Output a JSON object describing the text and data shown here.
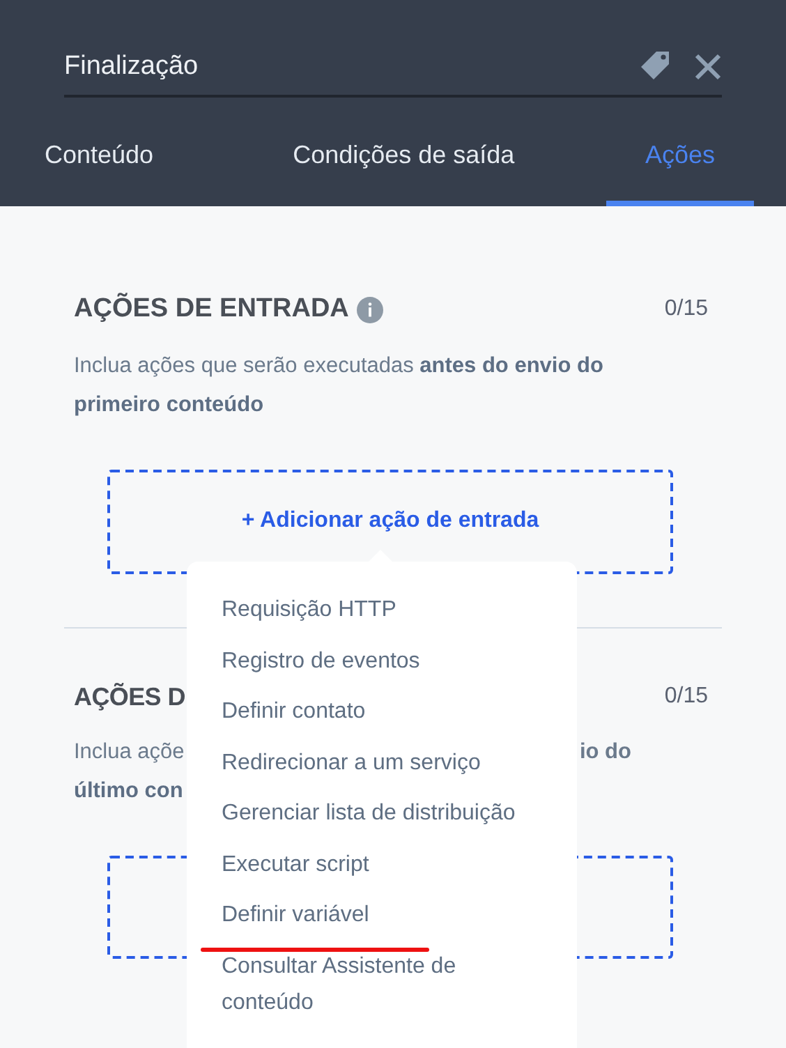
{
  "header": {
    "title": "Finalização"
  },
  "tabs": [
    {
      "label": "Conteúdo",
      "selected": false
    },
    {
      "label": "Condições de saída",
      "selected": false
    },
    {
      "label": "Ações",
      "selected": true
    }
  ],
  "entry_section": {
    "title": "AÇÕES DE ENTRADA",
    "count": "0/15",
    "description": "Inclua ações que serão executadas **antes do envio do primeiro conteúdo**",
    "add_button": "+ Adicionar ação de entrada"
  },
  "exit_section": {
    "title": "AÇÕES D",
    "count": "0/15",
    "description_left": [
      "Inclua açõe",
      "**último con**"
    ],
    "description_right": "io do"
  },
  "menu": {
    "items": [
      {
        "label": "Requisição HTTP",
        "underlined": false
      },
      {
        "label": "Registro de eventos",
        "underlined": false
      },
      {
        "label": "Definir contato",
        "underlined": false
      },
      {
        "label": "Redirecionar a um serviço",
        "underlined": false
      },
      {
        "label": "Gerenciar lista de distribuição",
        "underlined": false
      },
      {
        "label": "Executar script",
        "underlined": false
      },
      {
        "label": "Definir variável",
        "underlined": true
      },
      {
        "label": "Consultar Assistente de conteúdo",
        "underlined": false
      }
    ]
  }
}
